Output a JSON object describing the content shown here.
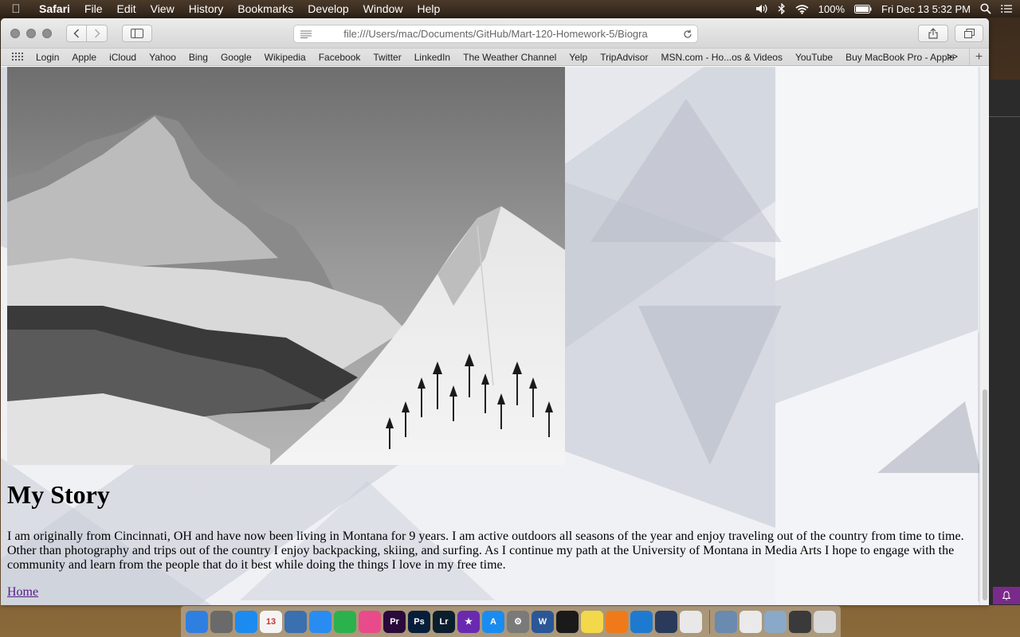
{
  "menubar": {
    "app_name": "Safari",
    "items": [
      "File",
      "Edit",
      "View",
      "History",
      "Bookmarks",
      "Develop",
      "Window",
      "Help"
    ],
    "battery": "100%",
    "datetime": "Fri Dec 13  5:32 PM"
  },
  "toolbar": {
    "url": "file:///Users/mac/Documents/GitHub/Mart-120-Homework-5/Biogra"
  },
  "favorites": [
    "Login",
    "Apple",
    "iCloud",
    "Yahoo",
    "Bing",
    "Google",
    "Wikipedia",
    "Facebook",
    "Twitter",
    "LinkedIn",
    "The Weather Channel",
    "Yelp",
    "TripAdvisor",
    "MSN.com - Ho...os & Videos",
    "YouTube",
    "Buy MacBook Pro - Apple"
  ],
  "favorites_more": ">>",
  "page": {
    "heading": "My Story",
    "paragraph": "I am originally from Cincinnati, OH and have now been living in Montana for 9 years. I am active outdoors all seasons of the year and enjoy traveling out of the country from time to time. Other than photography and trips out of the country I enjoy backpacking, skiing, and surfing. As I continue my path at the University of Montana in Media Arts I hope to engage with the community and learn from the people that do it best while doing the things I love in my free time.",
    "home_link": "Home"
  },
  "dock": {
    "apps": [
      {
        "name": "finder",
        "label": "",
        "color": "#2f7fe0"
      },
      {
        "name": "launchpad",
        "label": "",
        "color": "#6a6a6a"
      },
      {
        "name": "safari",
        "label": "",
        "color": "#1c8bf0"
      },
      {
        "name": "calendar",
        "label": "13",
        "color": "#f4f4f4"
      },
      {
        "name": "preview",
        "label": "",
        "color": "#3a6fb0"
      },
      {
        "name": "messages-bubble",
        "label": "",
        "color": "#2a8cf0"
      },
      {
        "name": "facetime",
        "label": "",
        "color": "#2bb24c"
      },
      {
        "name": "itunes",
        "label": "",
        "color": "#e94b8a"
      },
      {
        "name": "premiere",
        "label": "Pr",
        "color": "#2a0a3a"
      },
      {
        "name": "photoshop",
        "label": "Ps",
        "color": "#061e3a"
      },
      {
        "name": "lightroom",
        "label": "Lr",
        "color": "#0a1e2e"
      },
      {
        "name": "imovie-star",
        "label": "★",
        "color": "#6a2ab0"
      },
      {
        "name": "app-store",
        "label": "A",
        "color": "#1a8cf0"
      },
      {
        "name": "system-preferences",
        "label": "⚙",
        "color": "#7a7a7a"
      },
      {
        "name": "word",
        "label": "W",
        "color": "#2b5797"
      },
      {
        "name": "activity-monitor",
        "label": "",
        "color": "#1a1a1a"
      },
      {
        "name": "stickies",
        "label": "",
        "color": "#f2d84a"
      },
      {
        "name": "firefox",
        "label": "",
        "color": "#f07a1a"
      },
      {
        "name": "vscode",
        "label": "",
        "color": "#1e7ad0"
      },
      {
        "name": "xcode-hammer",
        "label": "",
        "color": "#2a3a5a"
      },
      {
        "name": "textedit",
        "label": "",
        "color": "#e8e8e8"
      }
    ],
    "right_items": [
      {
        "name": "downloads-stack",
        "color": "#6a8ab0"
      },
      {
        "name": "documents-stack",
        "color": "#eaeaea"
      },
      {
        "name": "screen-sharing",
        "color": "#8aa8c8"
      },
      {
        "name": "photos-stack",
        "color": "#3a3a3a"
      },
      {
        "name": "trash",
        "color": "#d8d8d8"
      }
    ]
  }
}
